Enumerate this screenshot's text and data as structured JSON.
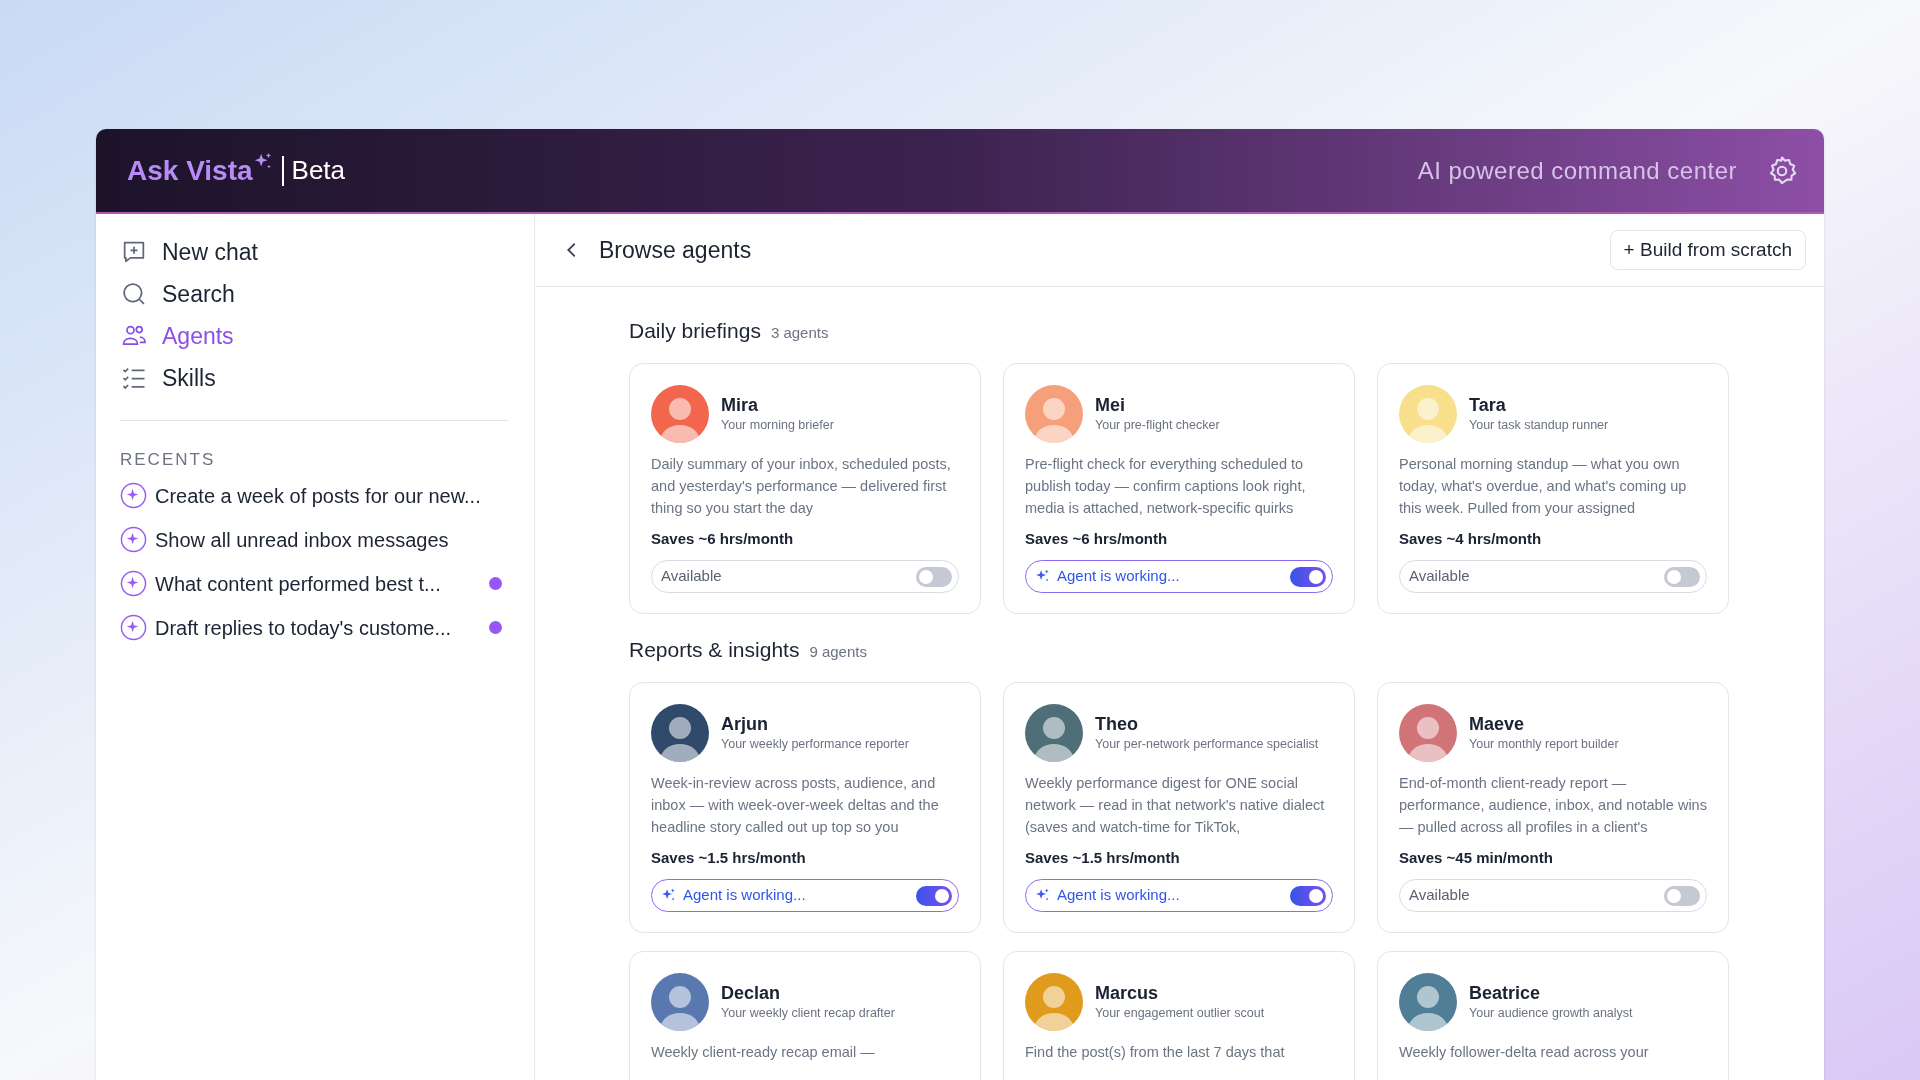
{
  "header": {
    "brand": "Ask Vista",
    "badge": "Beta",
    "tagline": "AI powered command center"
  },
  "nav": [
    {
      "label": "New chat",
      "kind": "new",
      "selected": false
    },
    {
      "label": "Search",
      "kind": "search",
      "selected": false
    },
    {
      "label": "Agents",
      "kind": "agents",
      "selected": true
    },
    {
      "label": "Skills",
      "kind": "skills",
      "selected": false
    }
  ],
  "recents": {
    "title": "RECENTS",
    "items": [
      {
        "label": "Create a week of posts for our new...",
        "unread": false
      },
      {
        "label": "Show all unread inbox messages",
        "unread": false
      },
      {
        "label": "What content performed best t...",
        "unread": true
      },
      {
        "label": "Draft replies to today's custome...",
        "unread": true
      }
    ]
  },
  "main": {
    "title": "Browse agents",
    "action": "+ Build from scratch"
  },
  "sections": [
    {
      "title": "Daily briefings",
      "count": "3 agents",
      "agents": [
        {
          "name": "Mira",
          "role": "Your morning briefer",
          "color": "#f2664e",
          "description": "Daily summary of your inbox, scheduled posts, and yesterday's performance — delivered first thing so you start the day",
          "saves": "Saves ~6 hrs/month",
          "status": {
            "label": "Available",
            "on": false
          }
        },
        {
          "name": "Mei",
          "role": "Your pre-flight checker",
          "color": "#f5a07a",
          "description": "Pre-flight check for everything scheduled to publish today — confirm captions look right, media is attached, network-specific quirks",
          "saves": "Saves ~6 hrs/month",
          "status": {
            "label": "Agent is working...",
            "on": true
          }
        },
        {
          "name": "Tara",
          "role": "Your task standup runner",
          "color": "#f7df8c",
          "description": "Personal morning standup — what you own today, what's overdue, and what's coming up this week. Pulled from your assigned",
          "saves": "Saves ~4 hrs/month",
          "status": {
            "label": "Available",
            "on": false
          }
        }
      ]
    },
    {
      "title": "Reports & insights",
      "count": "9 agents",
      "agents": [
        {
          "name": "Arjun",
          "role": "Your weekly performance reporter",
          "color": "#2f4a6b",
          "description": "Week-in-review across posts, audience, and inbox — with week-over-week deltas and the headline story called out up top so you",
          "saves": "Saves ~1.5 hrs/month",
          "status": {
            "label": "Agent is working...",
            "on": true
          }
        },
        {
          "name": "Theo",
          "role": "Your per-network performance specialist",
          "color": "#4e6e78",
          "description": "Weekly performance digest for ONE social network — read in that network's native dialect (saves and watch-time for TikTok,",
          "saves": "Saves ~1.5 hrs/month",
          "status": {
            "label": "Agent is working...",
            "on": true
          }
        },
        {
          "name": "Maeve",
          "role": "Your monthly report builder",
          "color": "#d17478",
          "description": "End-of-month client-ready report — performance, audience, inbox, and notable wins — pulled across all profiles in a client's",
          "saves": "Saves ~45 min/month",
          "status": {
            "label": "Available",
            "on": false
          }
        },
        {
          "name": "Declan",
          "role": "Your weekly client recap drafter",
          "color": "#5a78b0",
          "description": "Weekly client-ready recap email —"
        },
        {
          "name": "Marcus",
          "role": "Your engagement outlier scout",
          "color": "#e09a1c",
          "description": "Find the post(s) from the last 7 days that"
        },
        {
          "name": "Beatrice",
          "role": "Your audience growth analyst",
          "color": "#4f7e96",
          "description": "Weekly follower-delta read across your"
        }
      ]
    }
  ]
}
